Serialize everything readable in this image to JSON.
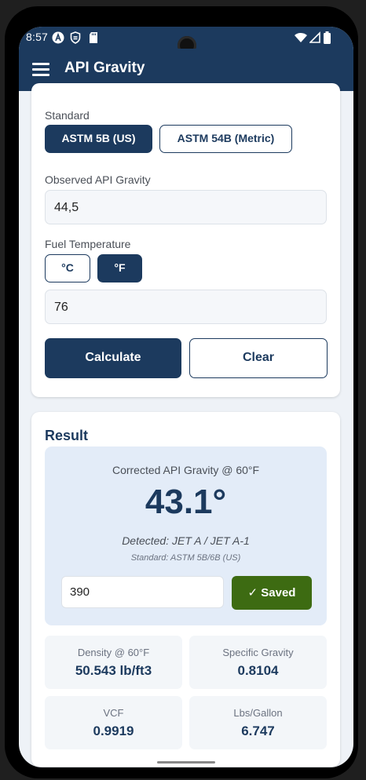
{
  "status_bar": {
    "time": "8:57"
  },
  "app_bar": {
    "title": "API Gravity",
    "menu_icon": "hamburger-menu-icon"
  },
  "form": {
    "standard_label": "Standard",
    "standard_options": [
      "ASTM 5B (US)",
      "ASTM 54B (Metric)"
    ],
    "standard_selected": "ASTM 5B (US)",
    "observed_label": "Observed API Gravity",
    "observed_value": "44,5",
    "temp_label": "Fuel Temperature",
    "temp_units": [
      "°C",
      "°F"
    ],
    "temp_unit_selected": "°F",
    "temp_value": "76",
    "calculate_label": "Calculate",
    "clear_label": "Clear"
  },
  "result": {
    "title": "Result",
    "corrected_label": "Corrected API Gravity @ 60°F",
    "corrected_value": "43.1°",
    "detected": "Detected: JET A / JET A-1",
    "standard_note": "Standard: ASTM 5B/6B (US)",
    "saved_input_value": "390",
    "saved_button_label": "✓ Saved",
    "stats": [
      {
        "label": "Density @ 60°F",
        "value": "50.543 lb/ft3"
      },
      {
        "label": "Specific Gravity",
        "value": "0.8104"
      },
      {
        "label": "VCF",
        "value": "0.9919"
      },
      {
        "label": "Lbs/Gallon",
        "value": "6.747"
      }
    ]
  },
  "colors": {
    "primary": "#1c3a5e",
    "saved_green": "#3d6b12",
    "result_panel_bg": "#e3ecf8"
  }
}
